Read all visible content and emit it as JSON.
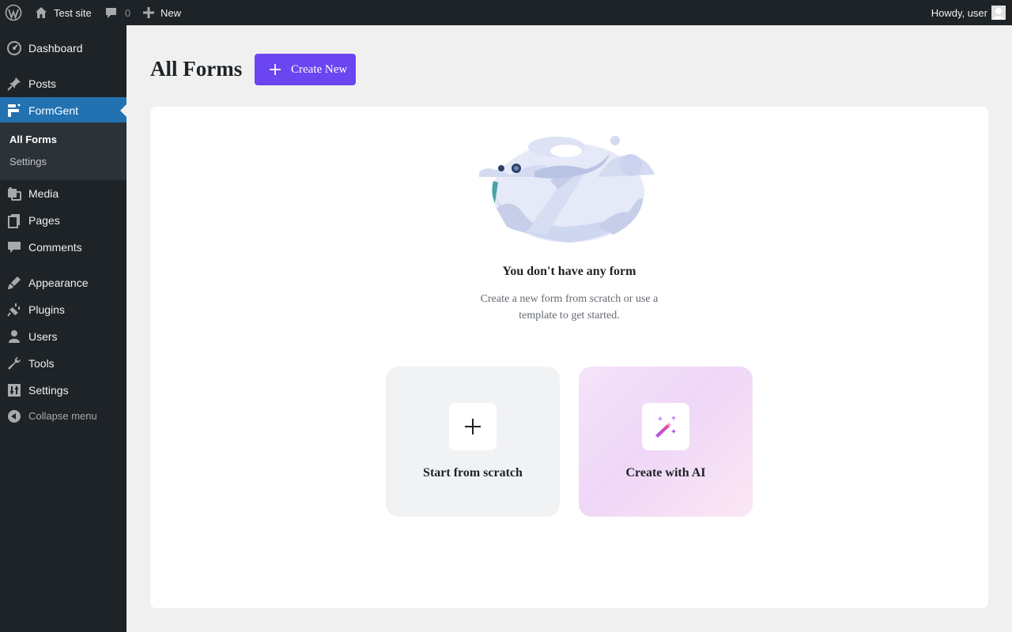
{
  "admin_bar": {
    "site_name": "Test site",
    "comments_count": "0",
    "new_label": "New",
    "greeting": "Howdy, user"
  },
  "sidebar": {
    "items": [
      {
        "label": "Dashboard",
        "icon": "dashboard-icon"
      },
      {
        "label": "Posts",
        "icon": "pin-icon"
      },
      {
        "label": "FormGent",
        "icon": "formgent-icon",
        "current": true
      },
      {
        "label": "Media",
        "icon": "media-icon"
      },
      {
        "label": "Pages",
        "icon": "pages-icon"
      },
      {
        "label": "Comments",
        "icon": "comment-icon"
      },
      {
        "label": "Appearance",
        "icon": "brush-icon"
      },
      {
        "label": "Plugins",
        "icon": "plug-icon"
      },
      {
        "label": "Users",
        "icon": "user-icon"
      },
      {
        "label": "Tools",
        "icon": "wrench-icon"
      },
      {
        "label": "Settings",
        "icon": "sliders-icon"
      }
    ],
    "submenu": [
      "All Forms",
      "Settings"
    ],
    "collapse_label": "Collapse menu"
  },
  "main": {
    "title": "All Forms",
    "create_button": "Create New",
    "empty_title": "You don't have any form",
    "empty_desc": "Create a new form from scratch or use a template to get started.",
    "options": [
      {
        "label": "Start from scratch",
        "icon": "plus-icon"
      },
      {
        "label": "Create with AI",
        "icon": "magic-wand-icon"
      }
    ]
  },
  "colors": {
    "admin_bg": "#1d2327",
    "current_menu": "#2271b1",
    "primary_button": "#6a45f0",
    "page_bg": "#f0f0f1"
  }
}
